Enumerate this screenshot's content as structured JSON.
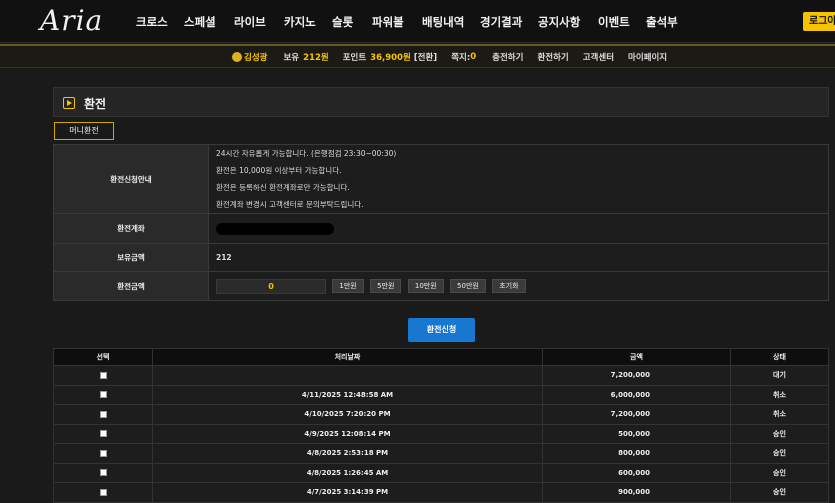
{
  "header": {
    "logo": "Aria",
    "menu": [
      "크로스",
      "스페셜",
      "라이브",
      "카지노",
      "슬롯",
      "파워볼",
      "배팅내역",
      "경기결과",
      "공지사항",
      "이벤트",
      "출석부"
    ],
    "login": "로그아"
  },
  "subbar": {
    "username": "김성광",
    "balance_label": "보유",
    "balance_value": "212원",
    "point_label": "포인트",
    "point_value": "36,900원",
    "point_convert": "[전환]",
    "message_label": "쪽지:",
    "message_value": "0",
    "links": [
      "충전하기",
      "환전하기",
      "고객센터",
      "마이페이지"
    ]
  },
  "panel": {
    "title": "환전",
    "tab": "머니환전"
  },
  "form": {
    "info_label": "환전신청안내",
    "info_lines": [
      "24시간 자유롭게 가능합니다. (은행점검 23:30~00:30)",
      "환전은 10,000원 이상부터 가능합니다.",
      "환전은 등록하신 환전계좌로만 가능합니다.",
      "환전계좌 변경시 고객센터로 문의부탁드립니다."
    ],
    "account_label": "환전계좌",
    "balance_label": "보유금액",
    "balance_value": "212",
    "amount_label": "환전금액",
    "amount_value": "0",
    "quick_buttons": [
      "1만원",
      "5만원",
      "10만원",
      "50만원",
      "초기화"
    ],
    "submit": "환전신청"
  },
  "history": {
    "headers": [
      "선택",
      "처리날짜",
      "금액",
      "상태"
    ],
    "rows": [
      {
        "date": "",
        "amount": "7,200,000",
        "status": "대기"
      },
      {
        "date": "4/11/2025 12:48:58 AM",
        "amount": "6,000,000",
        "status": "취소"
      },
      {
        "date": "4/10/2025 7:20:20 PM",
        "amount": "7,200,000",
        "status": "취소"
      },
      {
        "date": "4/9/2025 12:08:14 PM",
        "amount": "500,000",
        "status": "승인"
      },
      {
        "date": "4/8/2025 2:53:18 PM",
        "amount": "800,000",
        "status": "승인"
      },
      {
        "date": "4/8/2025 1:26:45 AM",
        "amount": "600,000",
        "status": "승인"
      },
      {
        "date": "4/7/2025 3:14:39 PM",
        "amount": "900,000",
        "status": "승인"
      }
    ]
  }
}
